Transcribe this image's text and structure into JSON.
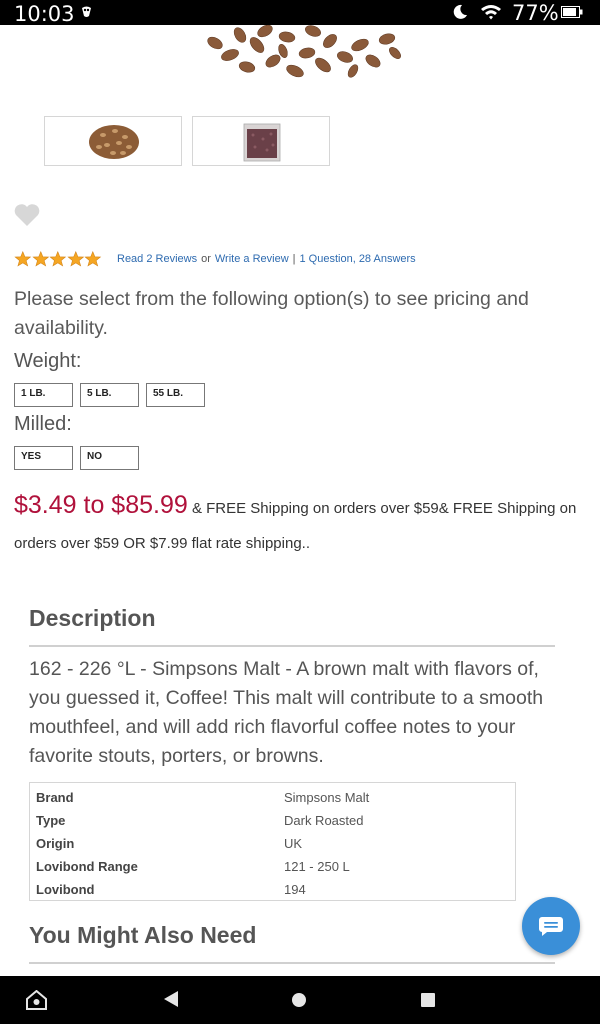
{
  "status_bar": {
    "time": "10:03",
    "battery_percent": "77%",
    "icons": [
      "notification-icon",
      "do-not-disturb-moon-icon",
      "wifi-icon",
      "battery-icon"
    ]
  },
  "gallery": {
    "images": [
      "malt-grains-pile",
      "malt-bag"
    ]
  },
  "rating": {
    "stars": 5,
    "read_reviews": "Read 2 Reviews",
    "or": "or",
    "write_review": "Write a Review",
    "separator": "|",
    "questions": "1 Question, 28 Answers"
  },
  "options": {
    "message": "Please select from the following option(s) to see pricing and availability.",
    "weight": {
      "label": "Weight:",
      "values": [
        "1 LB.",
        "5 LB.",
        "55 LB."
      ]
    },
    "milled": {
      "label": "Milled:",
      "values": [
        "YES",
        "NO"
      ]
    }
  },
  "price": {
    "range": "$3.49 to $85.99",
    "shipping_note": "& FREE Shipping on orders over $59& FREE Shipping on orders over $59 OR $7.99 flat rate shipping.."
  },
  "description": {
    "heading": "Description",
    "text": "162 - 226 °L - Simpsons Malt - A brown malt with flavors of, you guessed it, Coffee!  This malt will contribute to a smooth mouthfeel, and will add rich flavorful coffee notes to your favorite stouts, porters, or browns.",
    "specs": [
      {
        "key": "Brand",
        "value": "Simpsons Malt"
      },
      {
        "key": "Type",
        "value": "Dark Roasted"
      },
      {
        "key": "Origin",
        "value": "UK"
      },
      {
        "key": "Lovibond Range",
        "value": "121 - 250 L"
      },
      {
        "key": "Lovibond",
        "value": "194"
      }
    ]
  },
  "also_need": {
    "heading": "You Might Also Need"
  },
  "colors": {
    "price": "#b0113b",
    "link": "#2e6bb0",
    "star": "#f5a623",
    "chat": "#3a8fd8"
  }
}
